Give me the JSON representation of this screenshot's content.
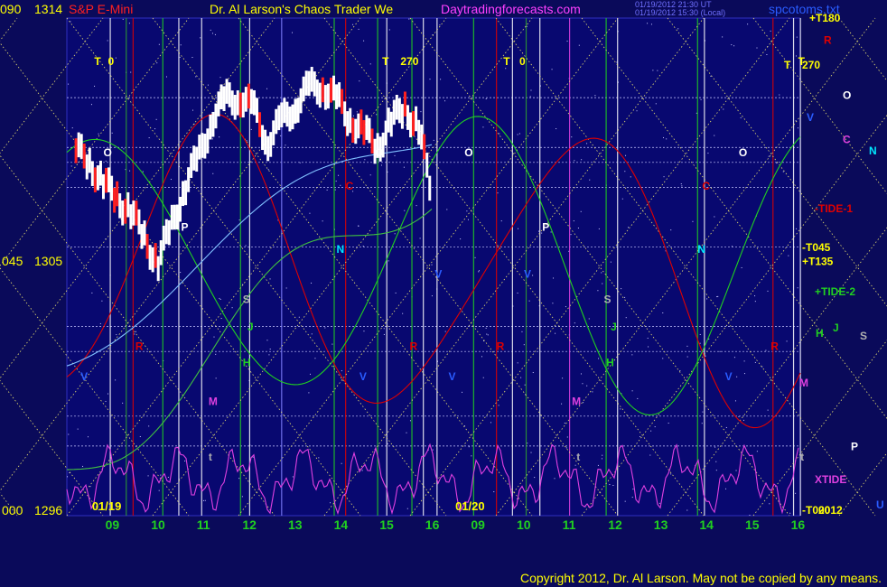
{
  "header": {
    "left_axis_top": "090",
    "price_top": "1314",
    "symbol": "S&P E-Mini",
    "title": "Dr. Al Larson's Chaos Trader We",
    "website": "Daytradingforecasts.com",
    "timestamp_1": "01/19/2012 21:30 UT",
    "timestamp_2": "01/19/2012 15:30 (Local)",
    "file_name": "spcotoms.txt"
  },
  "y_axis": {
    "mid_angle": "045",
    "mid_price": "1305",
    "bottom_angle": "000",
    "bottom_price": "1296"
  },
  "copyright": "Copyright 2012, Dr. Al Larson. May not be copied by any means.",
  "colors": {
    "background": "#0a0a5a",
    "plot_bg": "#080870",
    "yellow": "#ffff00",
    "red": "#e00000",
    "green": "#20d020",
    "cyan": "#80c0ff",
    "magenta": "#e040e0",
    "white": "#ffffff",
    "blue_label": "#2a5cff"
  },
  "chart_data": {
    "type": "line",
    "title": "Dr. Al Larson's Chaos Trader We",
    "xlabel": "",
    "ylabel": "",
    "ylim": [
      1296,
      1314
    ],
    "grid": true,
    "date_labels": [
      "01/19",
      "01/20"
    ],
    "hour_ticks": [
      "09",
      "10",
      "11",
      "12",
      "13",
      "14",
      "15",
      "16",
      "09",
      "10",
      "11",
      "12",
      "13",
      "14",
      "15",
      "16"
    ],
    "price_axis": [
      {
        "angle": "090",
        "price": 1314
      },
      {
        "angle": "045",
        "price": 1305
      },
      {
        "angle": "000",
        "price": 1296
      }
    ],
    "close_series": {
      "name": "",
      "x": [
        8.2,
        8.5,
        8.8,
        9.1,
        9.4,
        9.7,
        10.0,
        10.3,
        10.6,
        10.9,
        11.2,
        11.5,
        11.8,
        12.1,
        12.4,
        12.7,
        13.0,
        13.3,
        13.6,
        13.9,
        14.2,
        14.5,
        14.8,
        15.1,
        15.4,
        15.7,
        16.0
      ],
      "y": [
        1309.2,
        1308.8,
        1308.0,
        1307.5,
        1307.0,
        1306.0,
        1305.2,
        1306.5,
        1308.0,
        1309.0,
        1310.5,
        1311.0,
        1311.2,
        1310.6,
        1309.6,
        1310.2,
        1310.9,
        1311.4,
        1311.6,
        1311.0,
        1310.4,
        1309.8,
        1309.4,
        1310.2,
        1310.8,
        1310.0,
        1307.5
      ]
    },
    "forecast_curves": [
      {
        "name": "-TIDE-1",
        "color": "#e00000"
      },
      {
        "name": "+TIDE-2",
        "color": "#20d020"
      },
      {
        "name": "XTIDE",
        "color": "#e040e0"
      }
    ],
    "right_labels": [
      {
        "text": "+T180",
        "color": "#ffff00",
        "y": 1314
      },
      {
        "text": "R",
        "color": "#e00000",
        "y": 1313.2
      },
      {
        "text": "T",
        "color": "#ffff00",
        "y": 1312.3
      },
      {
        "text": "270",
        "color": "#ffff00",
        "y": 1312.3
      },
      {
        "text": "O",
        "color": "#ffffff",
        "y": 1311.2
      },
      {
        "text": "V",
        "color": "#2a5cff",
        "y": 1310.4
      },
      {
        "text": "C",
        "color": "#e040e0",
        "y": 1309.6
      },
      {
        "text": "N",
        "color": "#00e8ff",
        "y": 1309.2
      },
      {
        "text": "-TIDE-1",
        "color": "#e00000",
        "y": 1307.1
      },
      {
        "text": "-T045",
        "color": "#ffff00",
        "y": 1305.7
      },
      {
        "text": "+T135",
        "color": "#ffff00",
        "y": 1305.2
      },
      {
        "text": "+TIDE-2",
        "color": "#20d020",
        "y": 1304.1
      },
      {
        "text": "H",
        "color": "#20d020",
        "y": 1302.6
      },
      {
        "text": "J",
        "color": "#20d020",
        "y": 1302.8
      },
      {
        "text": "S",
        "color": "#b0b0b0",
        "y": 1302.5
      },
      {
        "text": "M",
        "color": "#e040e0",
        "y": 1300.8
      },
      {
        "text": "P",
        "color": "#ffffff",
        "y": 1298.5
      },
      {
        "text": "XTIDE",
        "color": "#e040e0",
        "y": 1297.3
      },
      {
        "text": "U",
        "color": "#2a5cff",
        "y": 1296.4
      },
      {
        "text": "-T000",
        "color": "#ffff00",
        "y": 1296.2
      },
      {
        "text": "2012",
        "color": "#ffff00",
        "y": 1296.2
      }
    ],
    "in_plot_labels": [
      {
        "text": "T",
        "color": "#ffff00",
        "x": 8.6,
        "y": 1312.3
      },
      {
        "text": "0",
        "color": "#ffff00",
        "x": 8.9,
        "y": 1312.3
      },
      {
        "text": "T",
        "color": "#ffff00",
        "x": 14.9,
        "y": 1312.3
      },
      {
        "text": "270",
        "color": "#ffff00",
        "x": 15.3,
        "y": 1312.3
      },
      {
        "text": "T",
        "color": "#ffff00",
        "x": 17.55,
        "y": 1312.3
      },
      {
        "text": "0",
        "color": "#ffff00",
        "x": 17.9,
        "y": 1312.3
      },
      {
        "text": "T",
        "color": "#ffff00",
        "x": 24.0,
        "y": 1312.3
      },
      {
        "text": "O",
        "color": "#ffffff",
        "x": 8.8,
        "y": 1309.0
      },
      {
        "text": "O",
        "color": "#ffffff",
        "x": 14.75,
        "y": 1309.0
      },
      {
        "text": "O",
        "color": "#ffffff",
        "x": 16.7,
        "y": 1309.0
      },
      {
        "text": "O",
        "color": "#ffffff",
        "x": 22.7,
        "y": 1309.0
      },
      {
        "text": "P",
        "color": "#ffffff",
        "x": 10.5,
        "y": 1306.3
      },
      {
        "text": "P",
        "color": "#ffffff",
        "x": 18.4,
        "y": 1306.3
      },
      {
        "text": "C",
        "color": "#e00000",
        "x": 14.1,
        "y": 1307.8
      },
      {
        "text": "C",
        "color": "#e00000",
        "x": 21.9,
        "y": 1307.8
      },
      {
        "text": "N",
        "color": "#00e8ff",
        "x": 13.9,
        "y": 1305.5
      },
      {
        "text": "N",
        "color": "#00e8ff",
        "x": 21.8,
        "y": 1305.5
      },
      {
        "text": "S",
        "color": "#b0b0b0",
        "x": 11.85,
        "y": 1303.7
      },
      {
        "text": "S",
        "color": "#b0b0b0",
        "x": 19.75,
        "y": 1303.7
      },
      {
        "text": "J",
        "color": "#20d020",
        "x": 11.95,
        "y": 1302.7
      },
      {
        "text": "J",
        "color": "#20d020",
        "x": 19.9,
        "y": 1302.7
      },
      {
        "text": "R",
        "color": "#e00000",
        "x": 9.5,
        "y": 1302.0
      },
      {
        "text": "R",
        "color": "#e00000",
        "x": 15.5,
        "y": 1302.0
      },
      {
        "text": "R",
        "color": "#e00000",
        "x": 17.4,
        "y": 1302.0
      },
      {
        "text": "R",
        "color": "#e00000",
        "x": 23.4,
        "y": 1302.0
      },
      {
        "text": "H",
        "color": "#20d020",
        "x": 11.85,
        "y": 1301.4
      },
      {
        "text": "H",
        "color": "#20d020",
        "x": 19.8,
        "y": 1301.4
      },
      {
        "text": "V",
        "color": "#2a5cff",
        "x": 8.3,
        "y": 1300.9
      },
      {
        "text": "V",
        "color": "#2a5cff",
        "x": 14.4,
        "y": 1300.9
      },
      {
        "text": "V",
        "color": "#2a5cff",
        "x": 16.35,
        "y": 1300.9
      },
      {
        "text": "V",
        "color": "#2a5cff",
        "x": 22.4,
        "y": 1300.9
      },
      {
        "text": "M",
        "color": "#e040e0",
        "x": 11.1,
        "y": 1300.0
      },
      {
        "text": "M",
        "color": "#e040e0",
        "x": 19.05,
        "y": 1300.0
      },
      {
        "text": "t",
        "color": "#b0b0b0",
        "x": 11.1,
        "y": 1298.0
      },
      {
        "text": "t",
        "color": "#b0b0b0",
        "x": 19.15,
        "y": 1298.0
      },
      {
        "text": "t",
        "color": "#b0b0b0",
        "x": 24.05,
        "y": 1298.0
      },
      {
        "text": "V",
        "color": "#2a5cff",
        "x": 16.05,
        "y": 1304.6
      },
      {
        "text": "V",
        "color": "#2a5cff",
        "x": 18.0,
        "y": 1304.6
      }
    ]
  }
}
